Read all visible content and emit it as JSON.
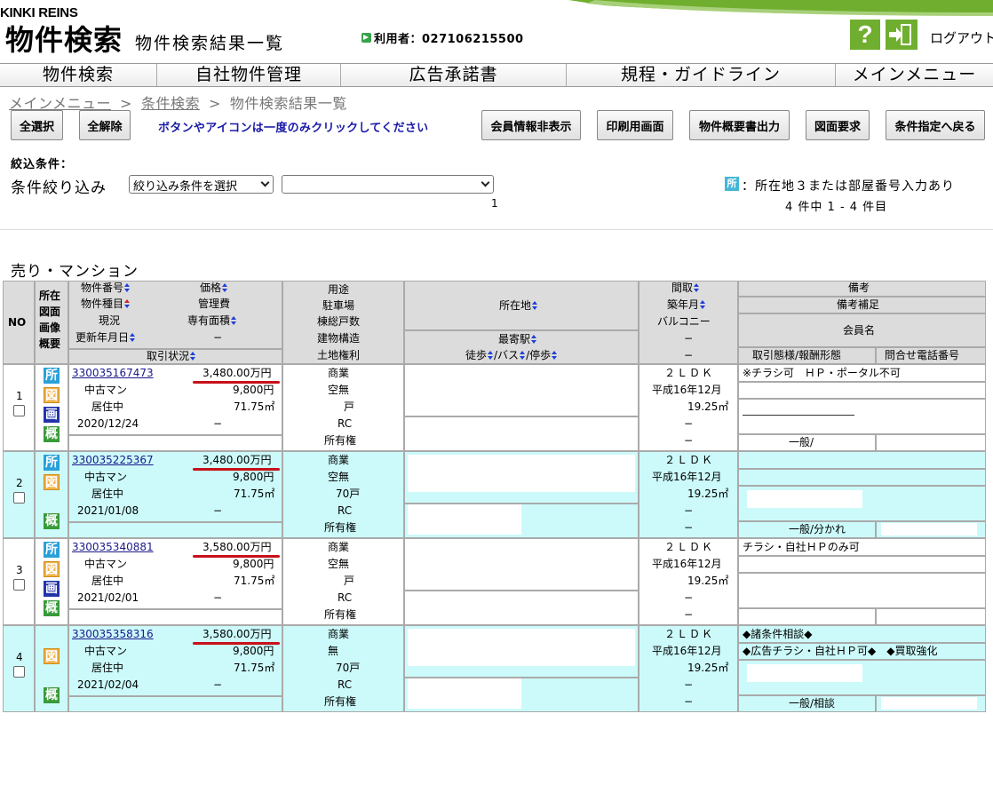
{
  "header": {
    "brand": "KINKI REINS",
    "app_title": "物件検索",
    "page_title": "物件検索結果一覧",
    "user_label": "利用者：027106215500",
    "logout_label": "ログアウト"
  },
  "nav": [
    "物件検索",
    "自社物件管理",
    "広告承諾書",
    "規程・ガイドライン",
    "メインメニュー"
  ],
  "breadcrumb": {
    "b1": "メインメニュー",
    "b2": "条件検索",
    "b3": "物件検索結果一覧",
    "sep": ">"
  },
  "toolbar": {
    "select_all": "全選択",
    "clear_all": "全解除",
    "notice": "ボタンやアイコンは一度のみクリックしてください",
    "hide_member": "会員情報非表示",
    "print": "印刷用画面",
    "summary_output": "物件概要書出力",
    "drawing_request": "図面要求",
    "back_to_conditions": "条件指定へ戻る"
  },
  "filter": {
    "heading": "絞込条件：",
    "label": "条件絞り込み",
    "select1": "絞り込み条件を選択",
    "select2": "",
    "page": "1",
    "legend_icon": "所",
    "legend_text": "：所在地３または部屋番号入力あり",
    "count": "4 件中 1 - 4 件目"
  },
  "section_title": "売り・マンション",
  "table": {
    "h_no": "NO",
    "h_icons": [
      "所在",
      "図面",
      "画像",
      "概要"
    ],
    "h_c1": [
      "物件番号",
      "物件種目",
      "現況",
      "更新年月日"
    ],
    "h_c2": [
      "価格",
      "管理費",
      "専有面積",
      "−"
    ],
    "h_c1c2_bottom": "取引状況",
    "h_c3": [
      "用途",
      "駐車場",
      "棟総戸数",
      "建物構造",
      "土地権利"
    ],
    "h_c4_top": "所在地",
    "h_c4_bottom1": "最寄駅",
    "h_c4_bottom2": [
      "徒歩",
      "/バス",
      "/停歩"
    ],
    "h_c5": [
      "間取",
      "築年月",
      "バルコニー",
      "−",
      "−"
    ],
    "h_c6": [
      "備考",
      "備考補足",
      "会員名"
    ],
    "h_c6_bottom": [
      "取引態様/報酬形態",
      "問合せ電話番号"
    ],
    "rows": [
      {
        "no": "1",
        "prop_no": "330035167473",
        "type": "中古マン",
        "status": "居住中",
        "updated": "2020/12/24",
        "price": "3,480.00万円",
        "mgmt_fee": "9,800円",
        "area": "71.75㎡",
        "dash": "−",
        "use": "商業",
        "parking": "空無",
        "units": "戸",
        "structure": "RC",
        "land": "所有権",
        "layout": "２ＬＤＫ",
        "built": "平成16年12月",
        "balcony": "19.25㎡",
        "d1": "−",
        "d2": "−",
        "remark": "※チラシ可　ＨＰ・ポータル不可",
        "transaction": "一般/",
        "icons": [
          "所",
          "図",
          "画",
          "概"
        ]
      },
      {
        "no": "2",
        "prop_no": "330035225367",
        "type": "中古マン",
        "status": "居住中",
        "updated": "2021/01/08",
        "price": "3,480.00万円",
        "mgmt_fee": "9,800円",
        "area": "71.75㎡",
        "dash": "−",
        "use": "商業",
        "parking": "空無",
        "units": "70戸",
        "structure": "RC",
        "land": "所有権",
        "layout": "２ＬＤＫ",
        "built": "平成16年12月",
        "balcony": "19.25㎡",
        "d1": "−",
        "d2": "−",
        "remark": "",
        "transaction": "一般/分かれ",
        "icons": [
          "所",
          "図",
          "",
          "概"
        ]
      },
      {
        "no": "3",
        "prop_no": "330035340881",
        "type": "中古マン",
        "status": "居住中",
        "updated": "2021/02/01",
        "price": "3,580.00万円",
        "mgmt_fee": "9,800円",
        "area": "71.75㎡",
        "dash": "−",
        "use": "商業",
        "parking": "空無",
        "units": "戸",
        "structure": "RC",
        "land": "所有権",
        "layout": "２ＬＤＫ",
        "built": "平成16年12月",
        "balcony": "19.25㎡",
        "d1": "−",
        "d2": "−",
        "remark": "チラシ・自社ＨＰのみ可",
        "transaction": "",
        "icons": [
          "所",
          "図",
          "画",
          "概"
        ]
      },
      {
        "no": "4",
        "prop_no": "330035358316",
        "type": "中古マン",
        "status": "居住中",
        "updated": "2021/02/04",
        "price": "3,580.00万円",
        "mgmt_fee": "9,800円",
        "area": "71.75㎡",
        "dash": "−",
        "use": "商業",
        "parking": "無",
        "units": "70戸",
        "structure": "RC",
        "land": "所有権",
        "layout": "２ＬＤＫ",
        "built": "平成16年12月",
        "balcony": "19.25㎡",
        "d1": "−",
        "d2": "−",
        "remark": "◆諸条件相談◆",
        "remark2": "◆広告チラシ・自社ＨＰ可◆　◆買取強化",
        "transaction": "一般/相談",
        "icons": [
          "",
          "図",
          "",
          "概"
        ]
      }
    ]
  },
  "colors": {
    "green": "#6fae2e",
    "row_alt": "#ccfafa",
    "header_gray": "#dcdcdc",
    "link": "#1a1a8c",
    "notice": "#1a1aa8",
    "red_underline": "#c8101a"
  }
}
